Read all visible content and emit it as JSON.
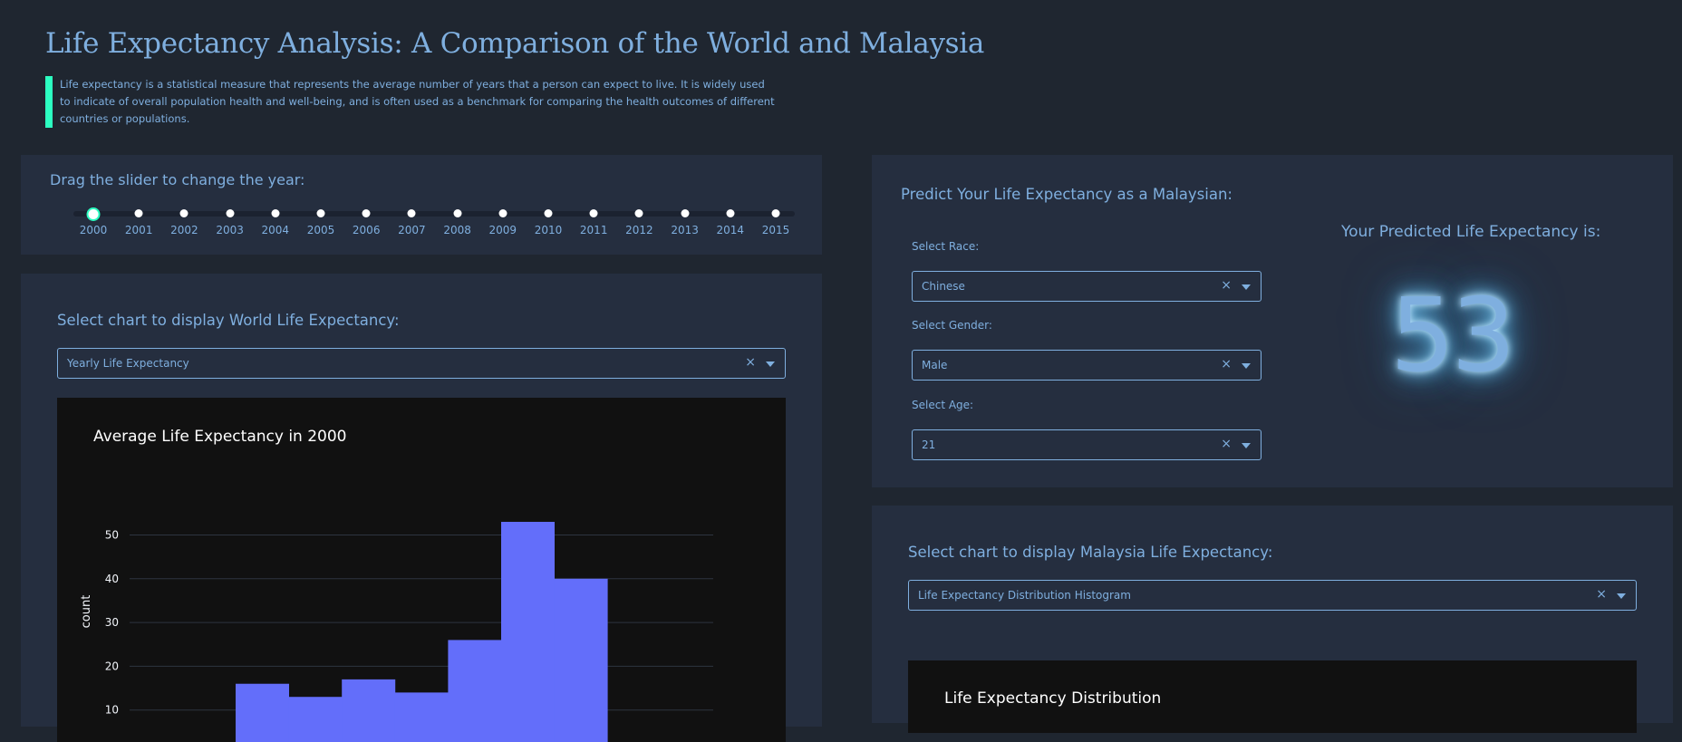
{
  "header": {
    "title": "Life Expectancy Analysis: A Comparison of the World and Malaysia",
    "description": "Life expectancy is a statistical measure that represents the average number of years that a person can expect to live. It is widely used to indicate of overall population health and well-being, and is often used as a benchmark for comparing the health outcomes of different countries or populations."
  },
  "slider": {
    "title": "Drag the slider to change the year:",
    "years": [
      "2000",
      "2001",
      "2002",
      "2003",
      "2004",
      "2005",
      "2006",
      "2007",
      "2008",
      "2009",
      "2010",
      "2011",
      "2012",
      "2013",
      "2014",
      "2015"
    ],
    "selected": "2000"
  },
  "world": {
    "label": "Select chart to display World Life Expectancy:",
    "dropdown_value": "Yearly Life Expectancy",
    "clear_icon": "×"
  },
  "predict": {
    "title": "Predict Your Life Expectancy as a Malaysian:",
    "race_label": "Select Race:",
    "race_value": "Chinese",
    "gender_label": "Select Gender:",
    "gender_value": "Male",
    "age_label": "Select Age:",
    "age_value": "21",
    "result_label": "Your Predicted Life Expectancy is:",
    "result_value": "53",
    "clear_icon": "×"
  },
  "malaysia": {
    "label": "Select chart to display Malaysia Life Expectancy:",
    "dropdown_value": "Life Expectancy Distribution Histogram",
    "chart_title": "Life Expectancy Distribution",
    "clear_icon": "×"
  },
  "colors": {
    "accent": "#2cfec1",
    "text": "#7fafdf",
    "panel": "#252e3f",
    "background": "#1f2630",
    "bar": "#636efa"
  },
  "chart_data": {
    "type": "bar",
    "title": "Average Life Expectancy in 2000",
    "ylabel": "count",
    "xlabel": "",
    "ylim": [
      0,
      55
    ],
    "yticks": [
      10,
      20,
      30,
      40,
      50
    ],
    "grid": true,
    "series": [
      {
        "values": [
          16,
          13,
          17,
          14,
          26,
          53,
          40
        ]
      }
    ]
  }
}
